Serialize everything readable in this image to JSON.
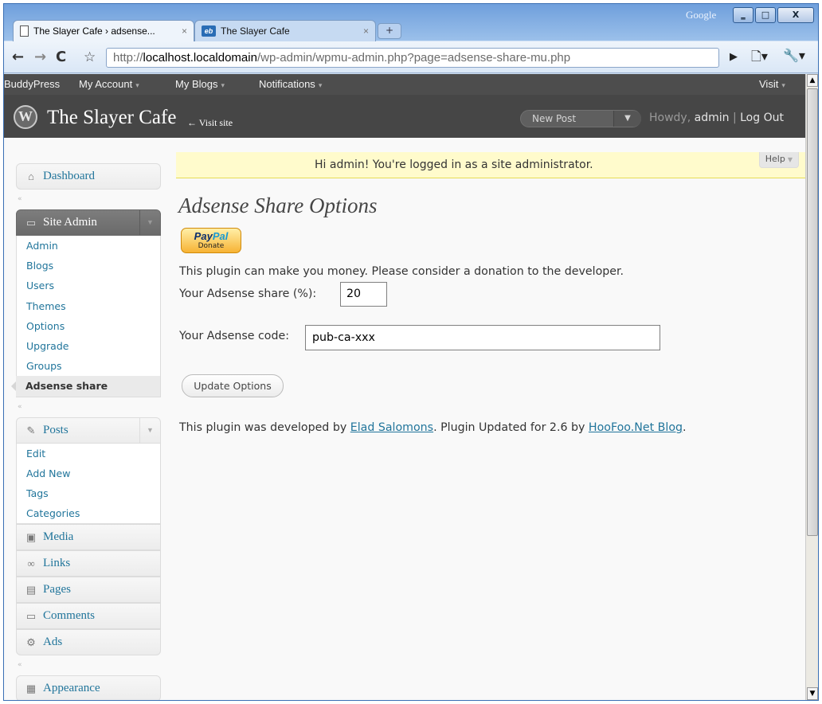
{
  "window": {
    "brand": "Google",
    "controls": {
      "minimize": "‗",
      "maximize": "□",
      "close": "X"
    },
    "new_tab_symbol": "+"
  },
  "tabs": [
    {
      "title": "The Slayer Cafe › adsense...",
      "close": "×",
      "icon": "page-icon"
    },
    {
      "title": "The Slayer Cafe",
      "close": "×",
      "icon": "eb-icon",
      "icon_text": "eb"
    }
  ],
  "toolbar": {
    "url_prefix": "http://",
    "url_host": "localhost.localdomain",
    "url_rest": "/wp-admin/wpmu-admin.php?page=adsense-share-mu.php"
  },
  "bpbar": {
    "brand": "BuddyPress",
    "items": [
      "My Account",
      "My Blogs",
      "Notifications"
    ],
    "visit": "Visit"
  },
  "header": {
    "site_title": "The Slayer Cafe",
    "visit_site": "← Visit site",
    "new_post": "New Post",
    "howdy_prefix": "Howdy,",
    "user": "admin",
    "separator": "|",
    "logout": "Log Out"
  },
  "menu": {
    "dashboard": "Dashboard",
    "site_admin": {
      "label": "Site Admin",
      "items": [
        "Admin",
        "Blogs",
        "Users",
        "Themes",
        "Options",
        "Upgrade",
        "Groups",
        "Adsense share"
      ],
      "active": "Adsense share"
    },
    "posts": {
      "label": "Posts",
      "items": [
        "Edit",
        "Add New",
        "Tags",
        "Categories"
      ]
    },
    "others": [
      "Media",
      "Links",
      "Pages",
      "Comments",
      "Ads"
    ],
    "appearance": "Appearance"
  },
  "notice": {
    "message": "Hi admin! You're logged in as a site administrator.",
    "help": "Help"
  },
  "content": {
    "heading": "Adsense Share Options",
    "paypal_brand_a": "Pay",
    "paypal_brand_b": "Pal",
    "paypal_donate": "Donate",
    "donate_note": "This plugin can make you money. Please consider a donation to the developer.",
    "share_label": "Your Adsense share (%):",
    "share_value": "20",
    "code_label": "Your Adsense code:",
    "code_value": "pub-ca-xxx",
    "update_button": "Update Options",
    "footer_prefix": "This plugin was developed by ",
    "footer_author": "Elad Salomons",
    "footer_middle": ". Plugin Updated for 2.6 by ",
    "footer_blog": "HooFoo.Net Blog",
    "footer_suffix": "."
  }
}
